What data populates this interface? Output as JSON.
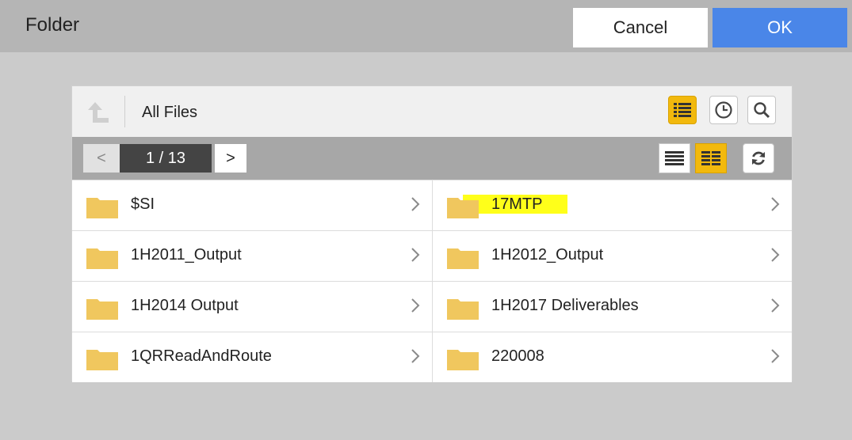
{
  "dialog": {
    "title": "Folder",
    "cancel_label": "Cancel",
    "ok_label": "OK"
  },
  "toolbar": {
    "breadcrumb": "All Files",
    "icons": [
      "up-arrow-icon",
      "list-view-icon",
      "recent-history-icon",
      "search-icon"
    ]
  },
  "pager": {
    "prev": "<",
    "page": "1 / 13",
    "next": ">",
    "icons": [
      "single-column-icon",
      "two-column-icon",
      "refresh-icon"
    ]
  },
  "folders": [
    {
      "name": "$SI"
    },
    {
      "name": "17MTP",
      "highlighted": true
    },
    {
      "name": "1H2011_Output"
    },
    {
      "name": "1H2012_Output"
    },
    {
      "name": "1H2014 Output"
    },
    {
      "name": "1H2017 Deliverables"
    },
    {
      "name": "1QRReadAndRoute"
    },
    {
      "name": "220008"
    }
  ],
  "colors": {
    "accent_blue": "#4a86e8",
    "active_yellow": "#f2b90d",
    "folder": "#f0c75e",
    "highlight": "#ffff1a"
  }
}
